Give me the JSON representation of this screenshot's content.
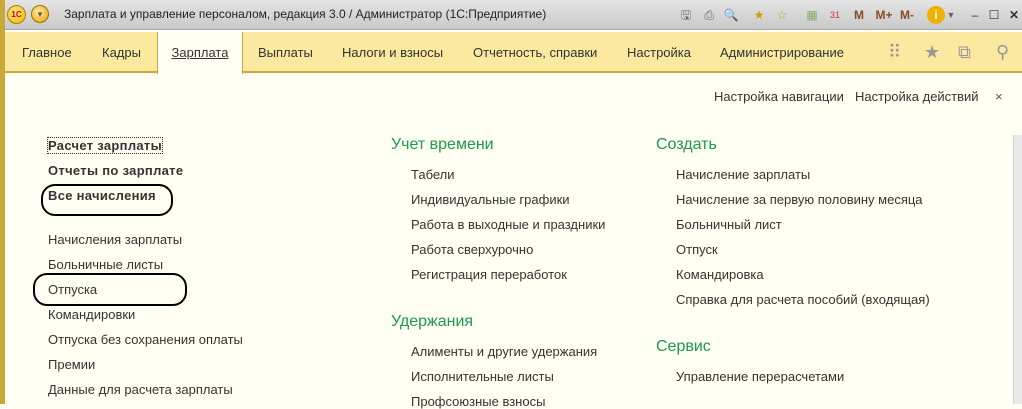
{
  "window": {
    "title": "Зарплата и управление персоналом, редакция 3.0 / Администратор  (1С:Предприятие)",
    "logo": "1С",
    "toolbar": {
      "m": "M",
      "mplus": "M+",
      "mminus": "M-"
    }
  },
  "tabs": [
    {
      "label": "Главное"
    },
    {
      "label": "Кадры"
    },
    {
      "label": "Зарплата"
    },
    {
      "label": "Выплаты"
    },
    {
      "label": "Налоги и взносы"
    },
    {
      "label": "Отчетность, справки"
    },
    {
      "label": "Настройка"
    },
    {
      "label": "Администрирование"
    }
  ],
  "header": {
    "nav_settings": "Настройка навигации",
    "action_settings": "Настройка действий",
    "close": "×"
  },
  "left": {
    "bold": [
      "Расчет зарплаты",
      "Отчеты по зарплате",
      "Все начисления"
    ],
    "items": [
      "Начисления зарплаты",
      "Больничные листы",
      "Отпуска",
      "Командировки",
      "Отпуска без сохранения оплаты",
      "Премии",
      "Данные для расчета зарплаты"
    ]
  },
  "time": {
    "heading": "Учет времени",
    "items": [
      "Табели",
      "Индивидуальные графики",
      "Работа в выходные и праздники",
      "Работа сверхурочно",
      "Регистрация переработок"
    ]
  },
  "deductions": {
    "heading": "Удержания",
    "items": [
      "Алименты и другие удержания",
      "Исполнительные листы",
      "Профсоюзные взносы"
    ]
  },
  "create": {
    "heading": "Создать",
    "items": [
      "Начисление зарплаты",
      "Начисление за первую половину месяца",
      "Больничный лист",
      "Отпуск",
      "Командировка",
      "Справка для расчета пособий (входящая)"
    ]
  },
  "service": {
    "heading": "Сервис",
    "items": [
      "Управление перерасчетами"
    ]
  }
}
